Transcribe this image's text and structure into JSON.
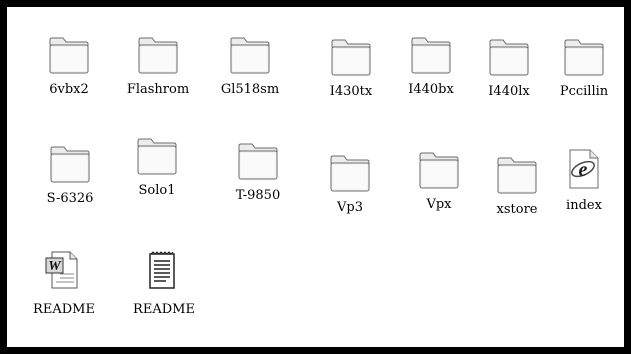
{
  "folder_view": {
    "items": [
      {
        "label": "6vbx2",
        "icon": "folder-icon"
      },
      {
        "label": "Flashrom",
        "icon": "folder-icon"
      },
      {
        "label": "Gl518sm",
        "icon": "folder-icon"
      },
      {
        "label": "I430tx",
        "icon": "folder-icon"
      },
      {
        "label": "I440bx",
        "icon": "folder-icon"
      },
      {
        "label": "I440lx",
        "icon": "folder-icon"
      },
      {
        "label": "Pccillin",
        "icon": "folder-icon"
      },
      {
        "label": "S-6326",
        "icon": "folder-icon"
      },
      {
        "label": "Solo1",
        "icon": "folder-icon"
      },
      {
        "label": "T-9850",
        "icon": "folder-icon"
      },
      {
        "label": "Vp3",
        "icon": "folder-icon"
      },
      {
        "label": "Vpx",
        "icon": "folder-icon"
      },
      {
        "label": "xstore",
        "icon": "folder-icon"
      },
      {
        "label": "index",
        "icon": "html-document-icon"
      },
      {
        "label": "README",
        "icon": "word-document-icon"
      },
      {
        "label": "README",
        "icon": "text-document-icon"
      }
    ]
  },
  "colors": {
    "background": "#000000",
    "window": "#ffffff",
    "folder_outline": "#606060",
    "folder_fill": "#f4f4f4"
  }
}
